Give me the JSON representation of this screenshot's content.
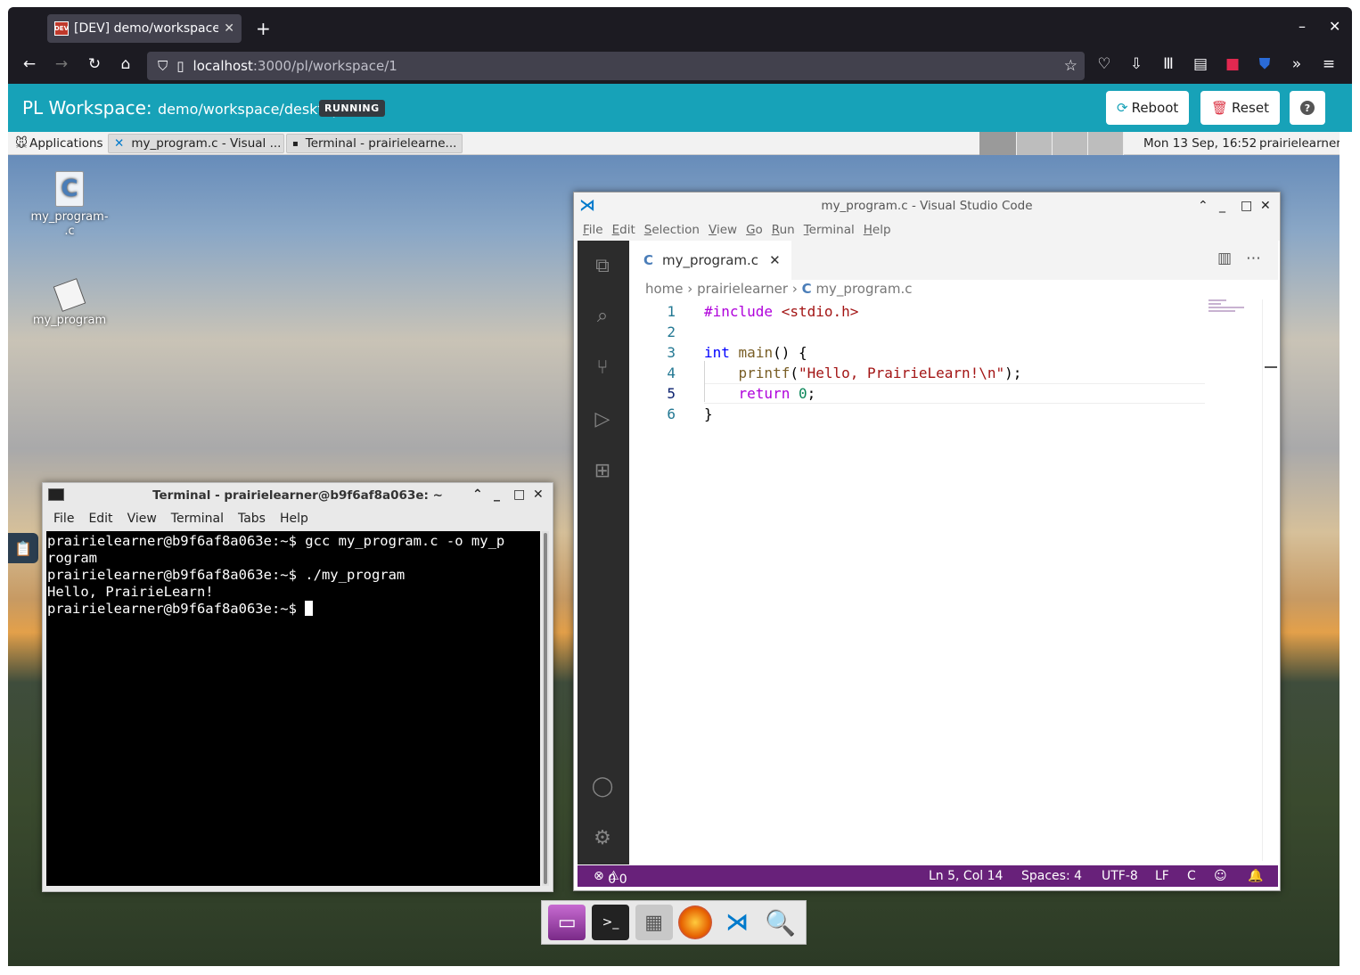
{
  "browser": {
    "tab_title": "[DEV] demo/workspace/d",
    "tab_favicon": "DEV",
    "url_host": "localhost",
    "url_path": ":3000/pl/workspace/1"
  },
  "pl": {
    "title": "PL Workspace",
    "subtitle": "demo/workspace/desktop",
    "status": "RUNNING",
    "reboot": "Reboot",
    "reset": "Reset",
    "help": "?"
  },
  "panel": {
    "applications": "Applications",
    "task_vscode": "my_program.c - Visual ...",
    "task_terminal": "Terminal - prairielearne...",
    "clock": "Mon 13 Sep, 16:52",
    "user": "prairielearner"
  },
  "desktop_icons": [
    {
      "label": "my_program-\n.c",
      "icon": "c-source-file-icon"
    },
    {
      "label": "my_program",
      "icon": "executable-file-icon"
    }
  ],
  "terminal": {
    "title": "Terminal - prairielearner@b9f6af8a063e: ~",
    "menu": [
      "File",
      "Edit",
      "View",
      "Terminal",
      "Tabs",
      "Help"
    ],
    "lines": [
      "prairielearner@b9f6af8a063e:~$ gcc my_program.c -o my_p",
      "rogram",
      "prairielearner@b9f6af8a063e:~$ ./my_program",
      "Hello, PrairieLearn!",
      "prairielearner@b9f6af8a063e:~$ "
    ]
  },
  "vscode": {
    "title": "my_program.c - Visual Studio Code",
    "menu": [
      "File",
      "Edit",
      "Selection",
      "View",
      "Go",
      "Run",
      "Terminal",
      "Help"
    ],
    "tab_lang": "C",
    "tab_label": "my_program.c",
    "breadcrumb": [
      "home",
      "prairielearner",
      "my_program.c"
    ],
    "line_numbers": [
      "1",
      "2",
      "3",
      "4",
      "5",
      "6"
    ],
    "status": {
      "errors": "0",
      "warnings": "0",
      "position": "Ln 5, Col 14",
      "spaces": "Spaces: 4",
      "encoding": "UTF-8",
      "eol": "LF",
      "language": "C"
    }
  },
  "colors": {
    "pl_bar": "#17a2b8",
    "vscode_status": "#68217a",
    "browser_chrome": "#1c1b22"
  }
}
